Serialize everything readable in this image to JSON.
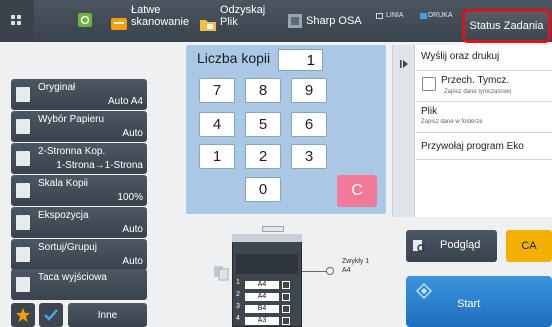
{
  "topbar": {
    "home_icon": "home-icon",
    "items": [
      {
        "label": "Łatwe skanowanie",
        "icon": "easy-scan-icon"
      },
      {
        "label": "Odzyskaj Plik",
        "icon": "retrieve-file-icon"
      },
      {
        "label": "Sharp OSA",
        "icon": "sharp-osa-icon"
      }
    ],
    "indicators": {
      "line": "LINIA",
      "data": "DRUKA"
    },
    "status_button": "Status Zadania"
  },
  "keypad": {
    "label": "Liczba kopii",
    "value": "1",
    "keys": [
      "7",
      "8",
      "9",
      "4",
      "5",
      "6",
      "1",
      "2",
      "3",
      "0"
    ],
    "clear": "C"
  },
  "left_menu": [
    {
      "title": "Oryginał",
      "value": "Auto A4",
      "icon": "original-icon"
    },
    {
      "title": "Wybór Papieru",
      "value": "Auto",
      "icon": "paper-select-icon"
    },
    {
      "title": "2-Stronna Kop.",
      "value": "1-Strona→1-Strona",
      "icon": "duplex-icon"
    },
    {
      "title": "Skala Kopii",
      "value": "100%",
      "icon": "copy-ratio-icon"
    },
    {
      "title": "Ekspozycja",
      "value": "Auto",
      "icon": "exposure-icon"
    },
    {
      "title": "Sortuj/Grupuj",
      "value": "Auto",
      "icon": "sort-group-icon"
    },
    {
      "title": "Taca wyjściowa",
      "value": "",
      "icon": "output-tray-icon"
    }
  ],
  "right_panel": {
    "send_print": "Wyślij oraz drukuj",
    "temp_store_title": "Przech. Tymcz.",
    "temp_store_sub": "Zapisz dane tymczasowo",
    "file_title": "Plik",
    "file_sub": "Zapisz dane w folderze",
    "eco": "Przywołaj program Eko"
  },
  "machine": {
    "paper_label_line1": "Zwykły 1",
    "paper_label_line2": "A4",
    "trays": [
      {
        "num": "1",
        "size": "A4"
      },
      {
        "num": "2",
        "size": "A4"
      },
      {
        "num": "3",
        "size": "B4"
      },
      {
        "num": "4",
        "size": "A3"
      }
    ]
  },
  "actions": {
    "preview": "Podgląd",
    "ca": "CA",
    "start": "Start"
  },
  "bottom_left": {
    "star_icon": "star-icon",
    "check_icon": "check-icon",
    "other": "Inne"
  },
  "colors": {
    "accent_blue": "#1e6fbe",
    "ca_yellow": "#f2b000",
    "clear_pink": "#f07a98",
    "status_border": "#d9141c",
    "keypad_bg": "#aac8e6"
  }
}
